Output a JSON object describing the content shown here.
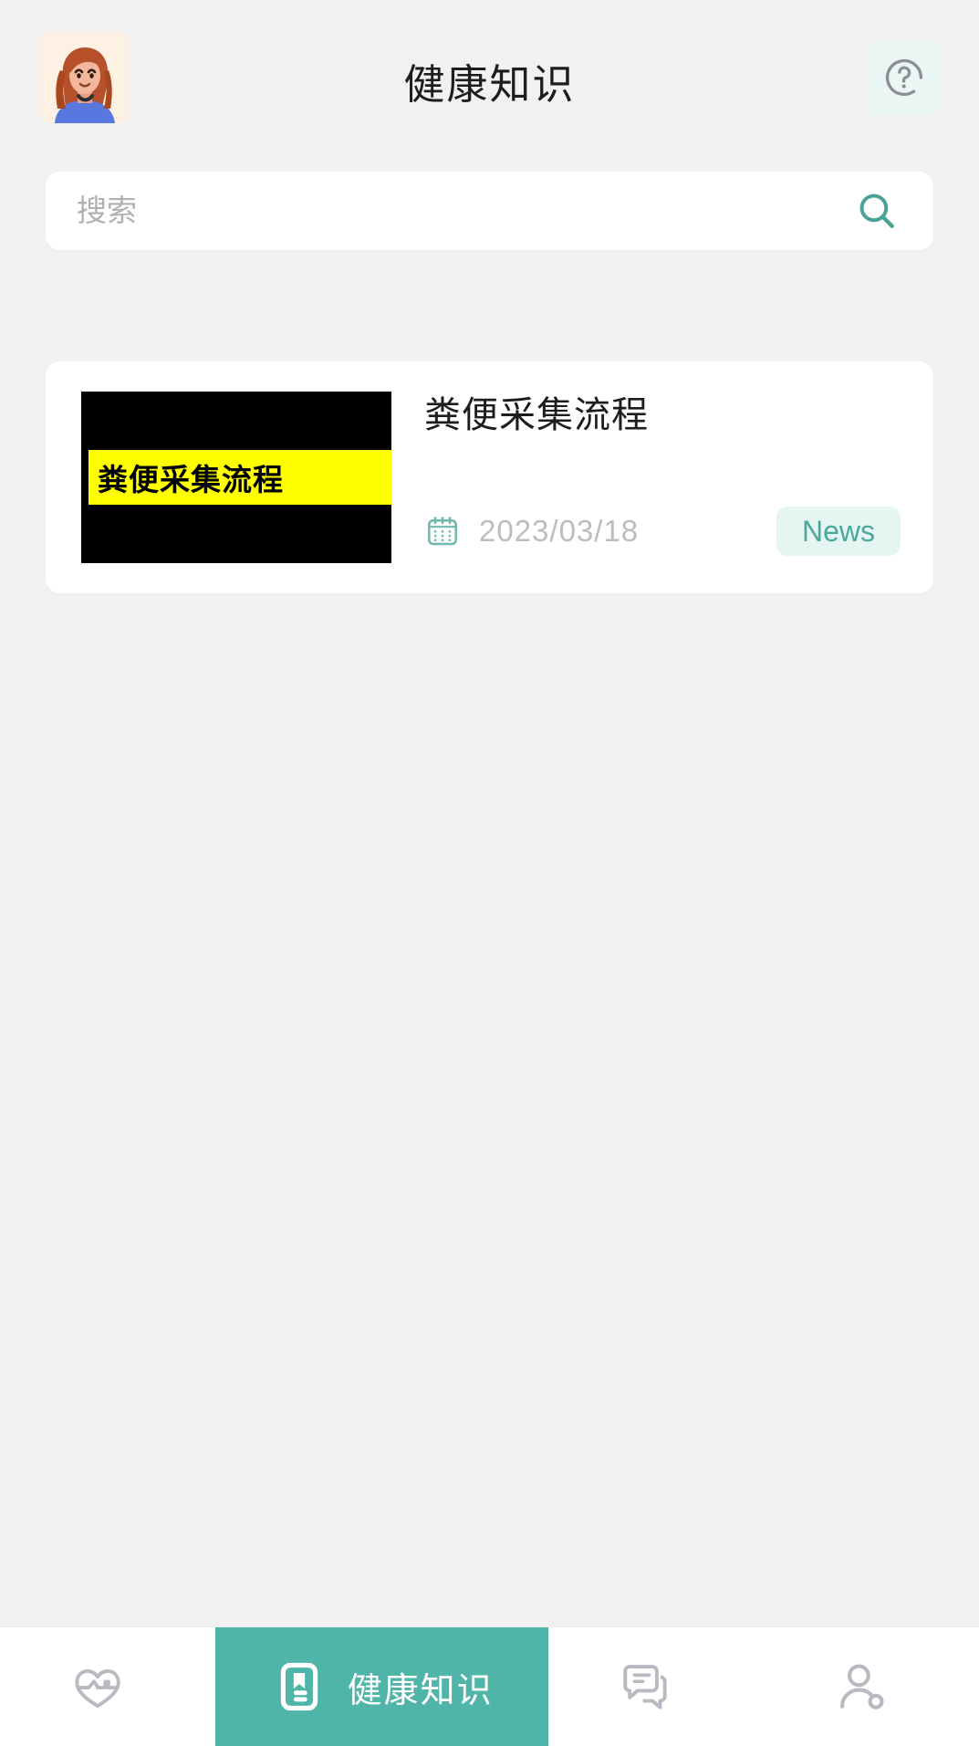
{
  "header": {
    "title": "健康知识",
    "avatar_icon": "user-avatar-illustration",
    "help_icon": "question-circle-icon"
  },
  "search": {
    "placeholder": "搜索",
    "value": "",
    "icon": "search-icon"
  },
  "articles": [
    {
      "title": "粪便采集流程",
      "thumbnail_text": "粪便采集流程",
      "date": "2023/03/18",
      "date_icon": "calendar-icon",
      "tag": "News"
    }
  ],
  "bottom_nav": {
    "items": [
      {
        "label": "",
        "icon": "heart-pulse-icon",
        "active": false
      },
      {
        "label": "健康知识",
        "icon": "book-knowledge-icon",
        "active": true
      },
      {
        "label": "",
        "icon": "chat-bubble-icon",
        "active": false
      },
      {
        "label": "",
        "icon": "user-profile-icon",
        "active": false
      }
    ]
  },
  "colors": {
    "accent_teal": "#4fb5a9",
    "icon_teal": "#4aa99c",
    "page_bg": "#f1f1f1",
    "card_bg": "#ffffff",
    "badge_bg": "#e4f5f2",
    "highlight_yellow": "#ffff00",
    "muted_text": "#bdbdbd"
  }
}
